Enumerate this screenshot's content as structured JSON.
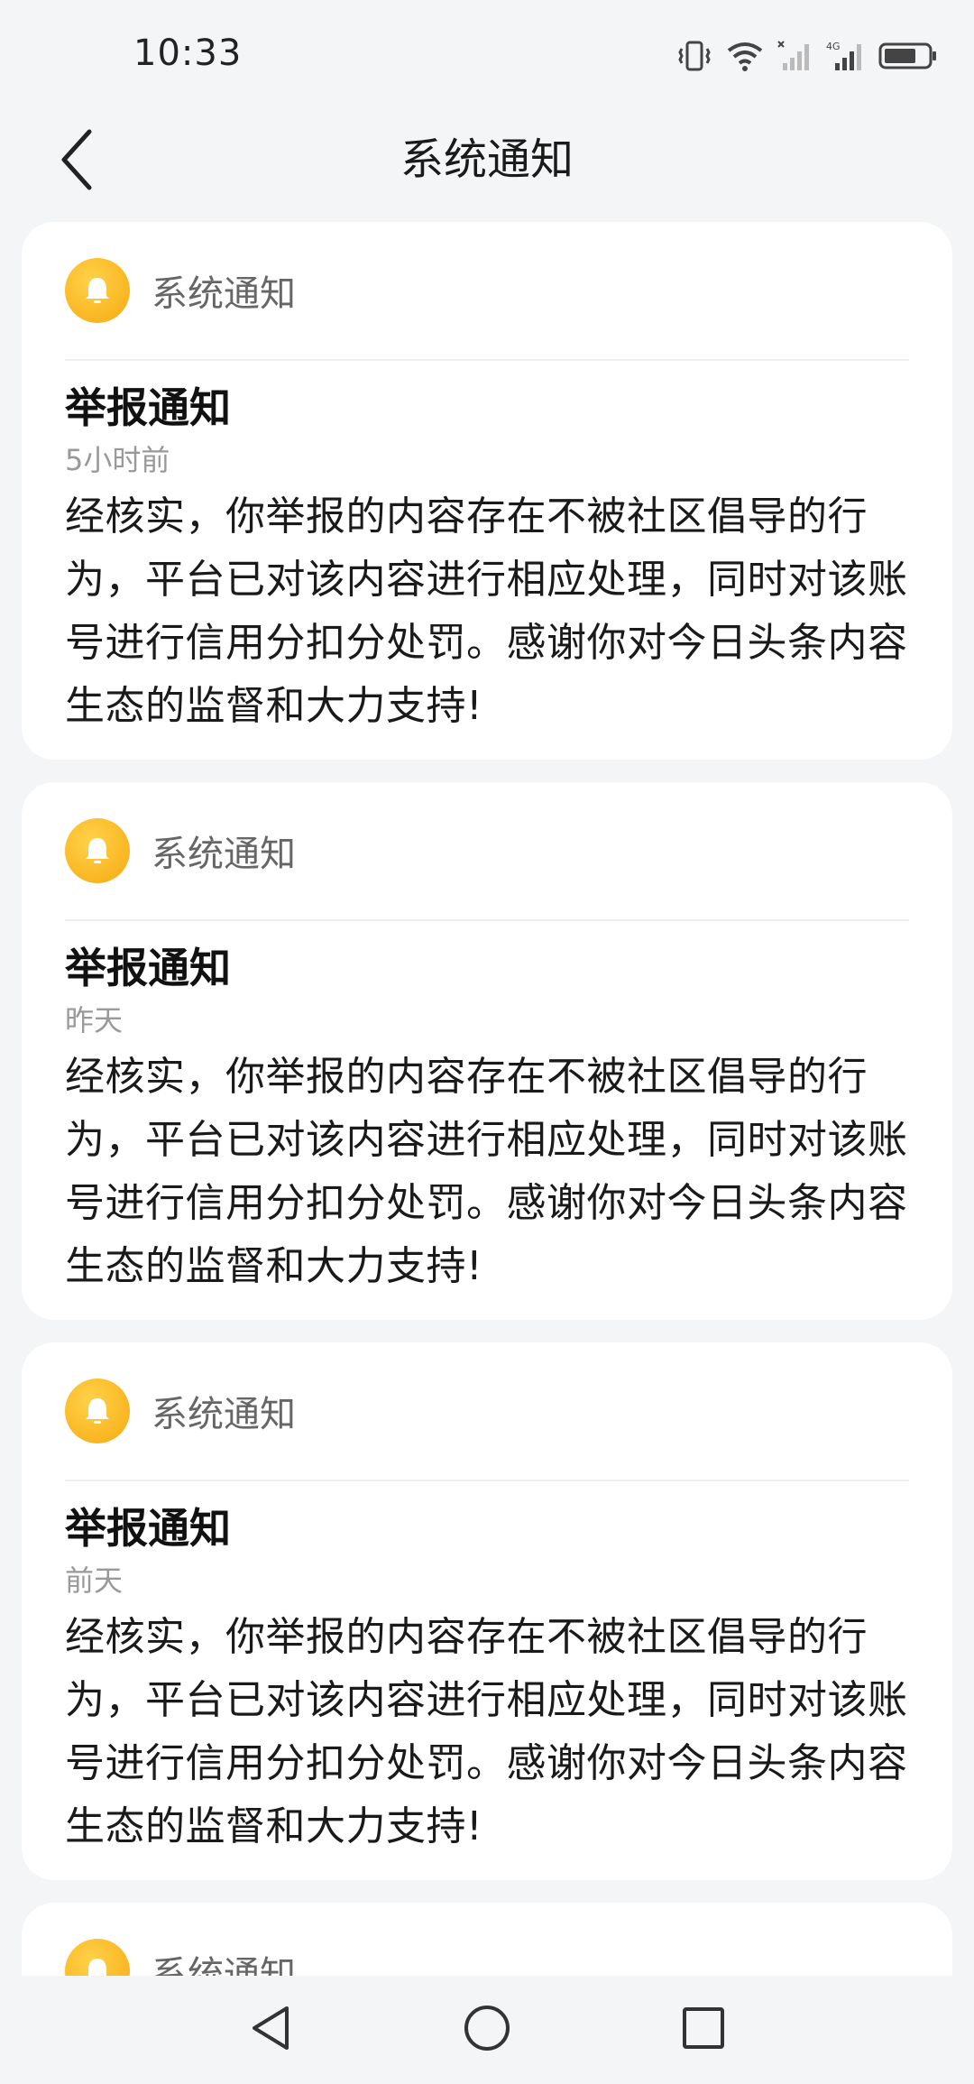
{
  "status_bar": {
    "time": "10:33",
    "network_label": "4G"
  },
  "header": {
    "title": "系统通知"
  },
  "notifications": [
    {
      "source": "系统通知",
      "title": "举报通知",
      "time": "5小时前",
      "body": "经核实，你举报的内容存在不被社区倡导的行为，平台已对该内容进行相应处理，同时对该账号进行信用分扣分处罚。感谢你对今日头条内容生态的监督和大力支持!"
    },
    {
      "source": "系统通知",
      "title": "举报通知",
      "time": "昨天",
      "body": "经核实，你举报的内容存在不被社区倡导的行为，平台已对该内容进行相应处理，同时对该账号进行信用分扣分处罚。感谢你对今日头条内容生态的监督和大力支持!"
    },
    {
      "source": "系统通知",
      "title": "举报通知",
      "time": "前天",
      "body": "经核实，你举报的内容存在不被社区倡导的行为，平台已对该内容进行相应处理，同时对该账号进行信用分扣分处罚。感谢你对今日头条内容生态的监督和大力支持!"
    },
    {
      "source": "系统通知"
    }
  ],
  "colors": {
    "background": "#f4f5f7",
    "card": "#ffffff",
    "bell": "#f7a910",
    "text_secondary": "#666666",
    "text_muted": "#999999"
  },
  "icons": {
    "back": "chevron-left-icon",
    "bell": "bell-icon",
    "nav_back": "triangle-back-icon",
    "nav_home": "circle-home-icon",
    "nav_recents": "square-recents-icon"
  }
}
